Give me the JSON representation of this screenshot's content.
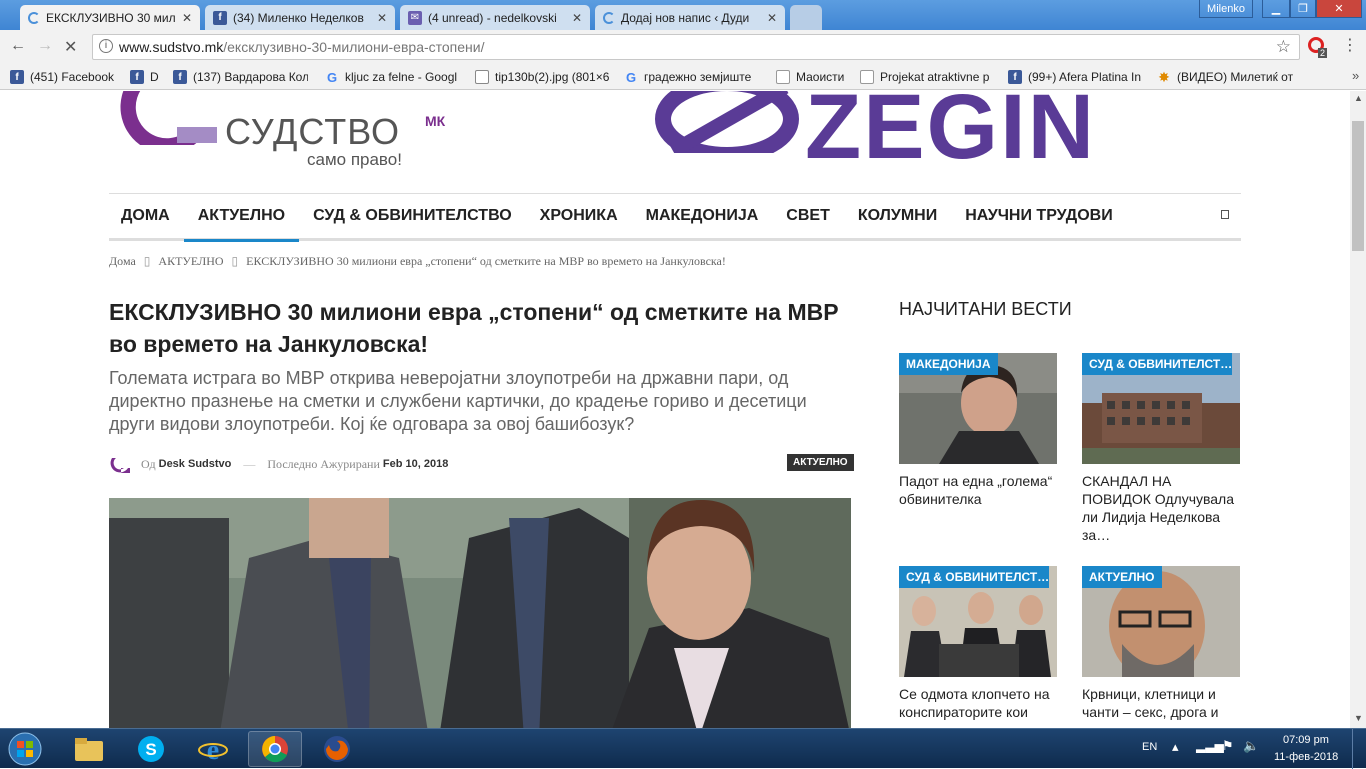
{
  "browser": {
    "tabs": [
      {
        "title": "ЕКСКЛУЗИВНО 30 мили",
        "active": true,
        "icon": "loading-icon"
      },
      {
        "title": "(34) Миленко Неделков",
        "active": false,
        "icon": "facebook-icon"
      },
      {
        "title": "(4 unread) - nedelkovski",
        "active": false,
        "icon": "mail-icon"
      },
      {
        "title": "Додај нов напис ‹ Дуди",
        "active": false,
        "icon": "loading-icon"
      }
    ],
    "user": "Milenko",
    "url_host": "www.sudstvo.mk",
    "url_path": "/ексклузивно-30-милиони-евра-стопени/",
    "bookmarks": [
      {
        "label": "(451) Facebook",
        "icon": "facebook-icon"
      },
      {
        "label": "D",
        "icon": "facebook-icon"
      },
      {
        "label": "(137) Вардарова Кол",
        "icon": "facebook-icon"
      },
      {
        "label": "kljuc za felne - Googl",
        "icon": "google-icon"
      },
      {
        "label": "tip130b(2).jpg (801×6",
        "icon": "file-icon"
      },
      {
        "label": "градежно земјиште",
        "icon": "google-icon"
      },
      {
        "label": "Маоисти",
        "icon": "page-icon"
      },
      {
        "label": "Projekat atraktivne p",
        "icon": "page-icon"
      },
      {
        "label": "(99+) Afera Platina In",
        "icon": "facebook-icon"
      },
      {
        "label": "(ВИДЕО) Милетиќ от",
        "icon": "star-icon"
      }
    ],
    "ext_badge": "2"
  },
  "site": {
    "logo_text": "СУДСТВО",
    "logo_sup": "МК",
    "logo_tagline": "само право!",
    "ad_text": "ZEGIN",
    "brand_color": "#7b2f8e",
    "accent_color": "#1a87c9"
  },
  "nav": [
    {
      "label": "ДОМА",
      "active": false
    },
    {
      "label": "АКТУЕЛНО",
      "active": true
    },
    {
      "label": "СУД & ОБВИНИТЕЛСТВО",
      "active": false
    },
    {
      "label": "ХРОНИКА",
      "active": false
    },
    {
      "label": "МАКЕДОНИЈА",
      "active": false
    },
    {
      "label": "СВЕТ",
      "active": false
    },
    {
      "label": "КОЛУМНИ",
      "active": false
    },
    {
      "label": "НАУЧНИ ТРУДОВИ",
      "active": false
    }
  ],
  "breadcrumb": {
    "home": "Дома",
    "section": "АКТУЕЛНО",
    "current": "ЕКСКЛУЗИВНО 30 милиони евра „стопени“ од сметките на МВР во времето на Јанкуловска!"
  },
  "article": {
    "title": "ЕКСКЛУЗИВНО 30 милиони евра „стопени“ од сметките на МВР во времето на Јанкуловска!",
    "lead": "Големата истрага во МВР открива неверојатни злоупотреби на државни пари, од директно празнење на сметки и службени картички, до крадење гориво и десетици други видови злоупотреби. Кој ќе одговара за овој башибозук?",
    "by_label": "Од",
    "author": "Desk Sudstvo",
    "dash": "—",
    "updated_label": "Последно Ажурирани",
    "date": "Feb 10, 2018",
    "category": "АКТУЕЛНО"
  },
  "sidebar": {
    "heading": "НАЈЧИТАНИ ВЕСТИ",
    "cards": [
      {
        "tag": "МАКЕДОНИЈА",
        "title": "Падот на една „голема“ обвинителка"
      },
      {
        "tag": "СУД & ОБВИНИТЕЛСТ…",
        "title": "СКАНДАЛ НА ПОВИДОК Одлучувала ли Лидија Неделкова за…"
      },
      {
        "tag": "СУД & ОБВИНИТЕЛСТ…",
        "title": "Се одмота клопчето на конспираторите кои"
      },
      {
        "tag": "АКТУЕЛНО",
        "title": "Крвници, клетници и чанти – секс, дрога и"
      }
    ]
  },
  "taskbar": {
    "lang": "EN",
    "time": "07:09 pm",
    "date": "11-фев-2018"
  }
}
